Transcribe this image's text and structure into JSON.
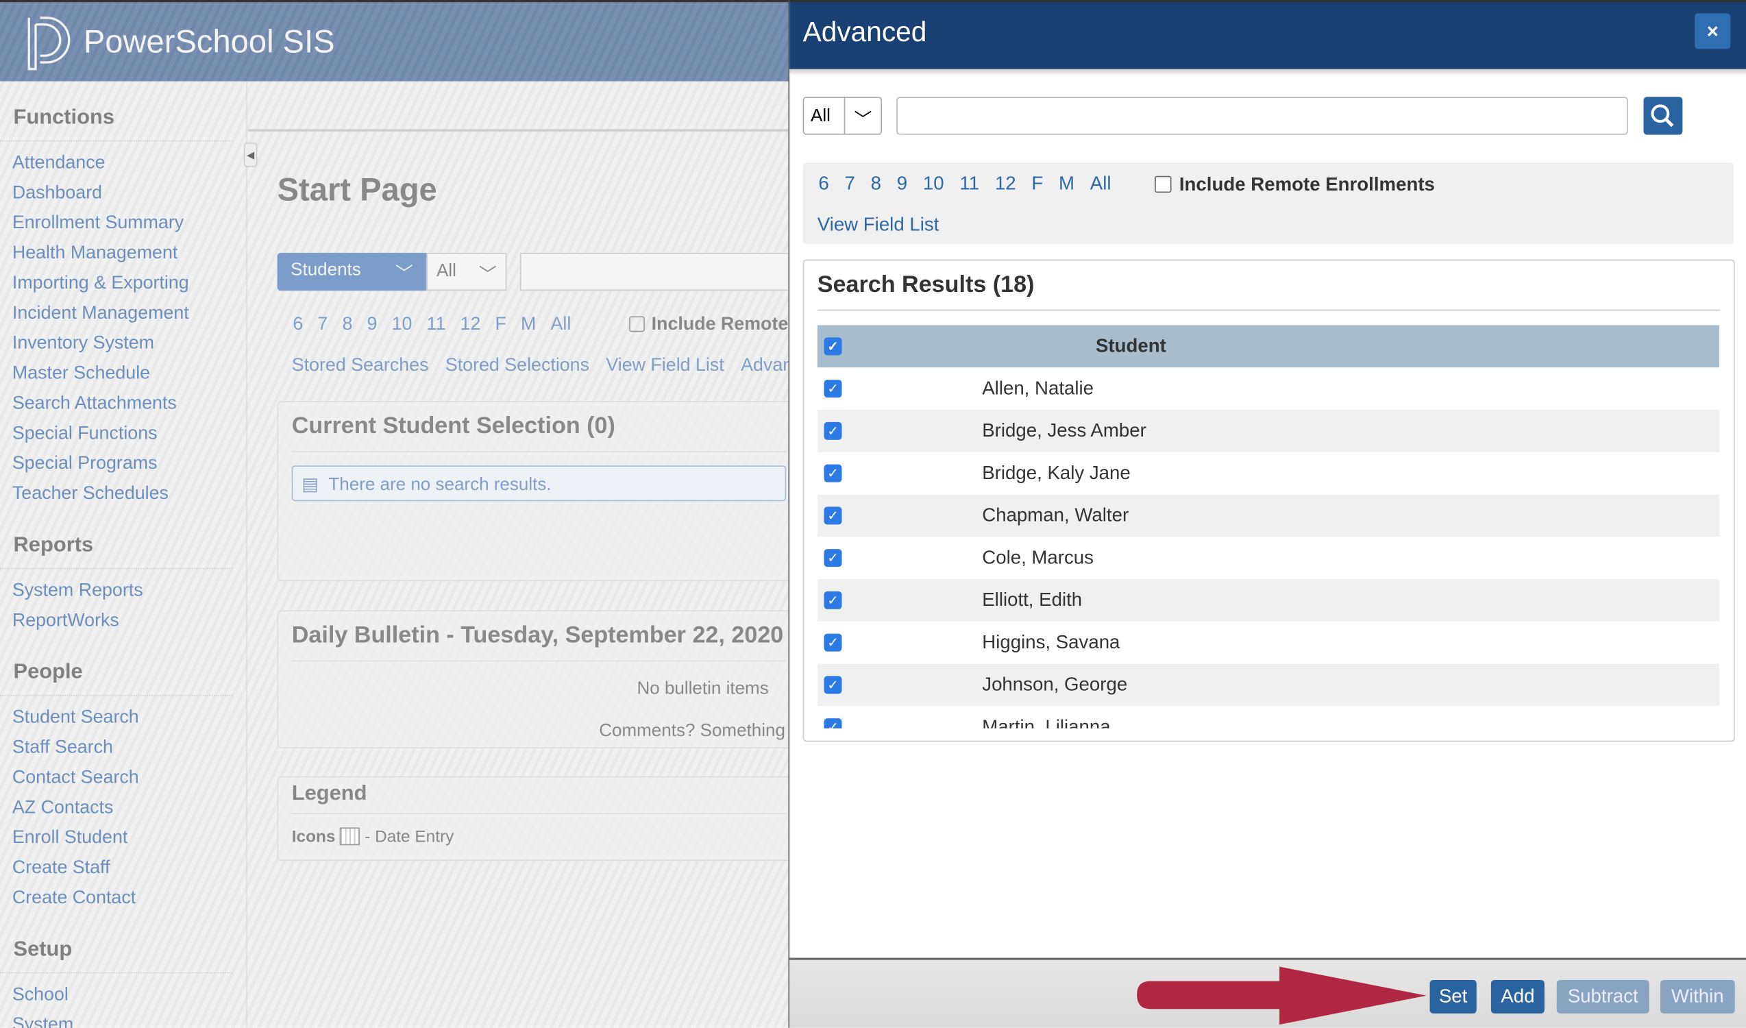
{
  "app": {
    "brand": "PowerSchool SIS"
  },
  "sidebar": {
    "groups": [
      {
        "title": "Functions",
        "items": [
          "Attendance",
          "Dashboard",
          "Enrollment Summary",
          "Health Management",
          "Importing & Exporting",
          "Incident Management",
          "Inventory System",
          "Master Schedule",
          "Search Attachments",
          "Special Functions",
          "Special Programs",
          "Teacher Schedules"
        ]
      },
      {
        "title": "Reports",
        "items": [
          "System Reports",
          "ReportWorks"
        ]
      },
      {
        "title": "People",
        "items": [
          "Student Search",
          "Staff Search",
          "Contact Search",
          "AZ Contacts",
          "Enroll Student",
          "Create Staff",
          "Create Contact"
        ]
      },
      {
        "title": "Setup",
        "items": [
          "School",
          "System"
        ]
      }
    ]
  },
  "main": {
    "title": "Start Page",
    "search_type": "Students",
    "scope": "All",
    "grades": [
      "6",
      "7",
      "8",
      "9",
      "10",
      "11",
      "12",
      "F",
      "M",
      "All"
    ],
    "include_remote": "Include Remote Enrollments",
    "links": [
      "Stored Searches",
      "Stored Selections",
      "View Field List",
      "Advanced"
    ],
    "selection_title": "Current Student Selection (0)",
    "no_results": "There are no search results.",
    "bulletin_title": "Daily Bulletin - Tuesday, September 22, 2020",
    "no_bulletin": "No bulletin items",
    "comments": "Comments? Something",
    "legend_title": "Legend",
    "legend_icons": "Icons",
    "legend_date": "- Date Entry"
  },
  "dialog": {
    "title": "Advanced",
    "close": "×",
    "scope": "All",
    "search_value": "",
    "grades": [
      "6",
      "7",
      "8",
      "9",
      "10",
      "11",
      "12",
      "F",
      "M",
      "All"
    ],
    "include_remote": "Include Remote Enrollments",
    "view_field_list": "View Field List",
    "results_title": "Search Results (18)",
    "column": "Student",
    "students": [
      "Allen, Natalie",
      "Bridge, Jess Amber",
      "Bridge, Kaly Jane",
      "Chapman, Walter",
      "Cole, Marcus",
      "Elliott, Edith",
      "Higgins, Savana",
      "Johnson, George",
      "Martin, Lilianna"
    ],
    "buttons": {
      "set": "Set",
      "add": "Add",
      "subtract": "Subtract",
      "within": "Within"
    },
    "colors": {
      "header": "#1a4174",
      "button": "#2a64a0",
      "button_disabled": "#88a4c0",
      "arrow": "#b02742"
    }
  }
}
